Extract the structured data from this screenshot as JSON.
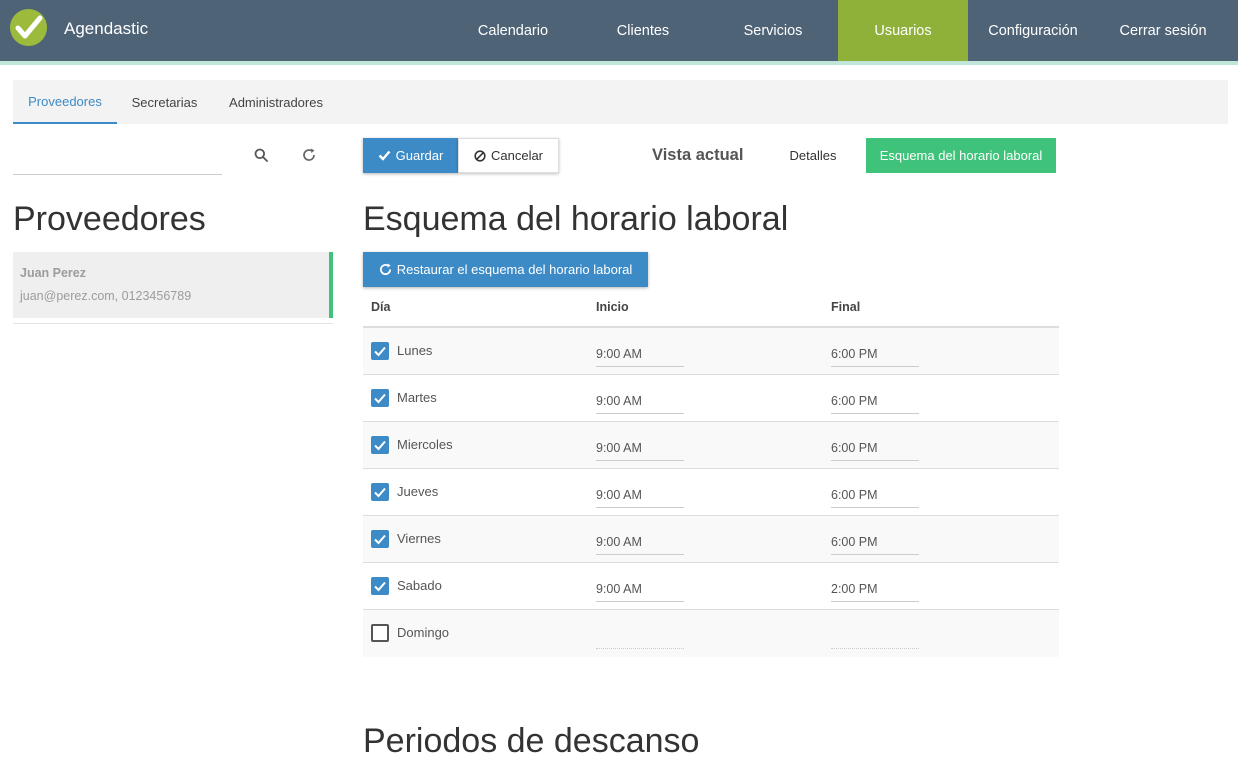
{
  "header": {
    "brand": "Agendastic",
    "nav": [
      "Calendario",
      "Clientes",
      "Servicios",
      "Usuarios",
      "Configuración",
      "Cerrar sesión"
    ],
    "active_nav": "Usuarios"
  },
  "subtabs": [
    "Proveedores",
    "Secretarias",
    "Administradores"
  ],
  "sidebar": {
    "search_value": "",
    "title": "Proveedores",
    "providers": [
      {
        "name": "Juan Perez",
        "info": "juan@perez.com, 0123456789"
      }
    ]
  },
  "toolbar": {
    "save_label": "Guardar",
    "cancel_label": "Cancelar",
    "view_label": "Vista actual",
    "details_label": "Detalles",
    "schedule_label": "Esquema del horario laboral"
  },
  "main": {
    "title": "Esquema del horario laboral",
    "reset_label": "Restaurar el esquema del horario laboral",
    "columns": [
      "Día",
      "Inicio",
      "Final"
    ],
    "rows": [
      {
        "day": "Lunes",
        "checked": true,
        "start": "9:00 AM",
        "end": "6:00 PM"
      },
      {
        "day": "Martes",
        "checked": true,
        "start": "9:00 AM",
        "end": "6:00 PM"
      },
      {
        "day": "Miercoles",
        "checked": true,
        "start": "9:00 AM",
        "end": "6:00 PM"
      },
      {
        "day": "Jueves",
        "checked": true,
        "start": "9:00 AM",
        "end": "6:00 PM"
      },
      {
        "day": "Viernes",
        "checked": true,
        "start": "9:00 AM",
        "end": "6:00 PM"
      },
      {
        "day": "Sabado",
        "checked": true,
        "start": "9:00 AM",
        "end": "2:00 PM"
      },
      {
        "day": "Domingo",
        "checked": false,
        "start": "",
        "end": ""
      }
    ],
    "breaks_title": "Periodos de descanso"
  }
}
